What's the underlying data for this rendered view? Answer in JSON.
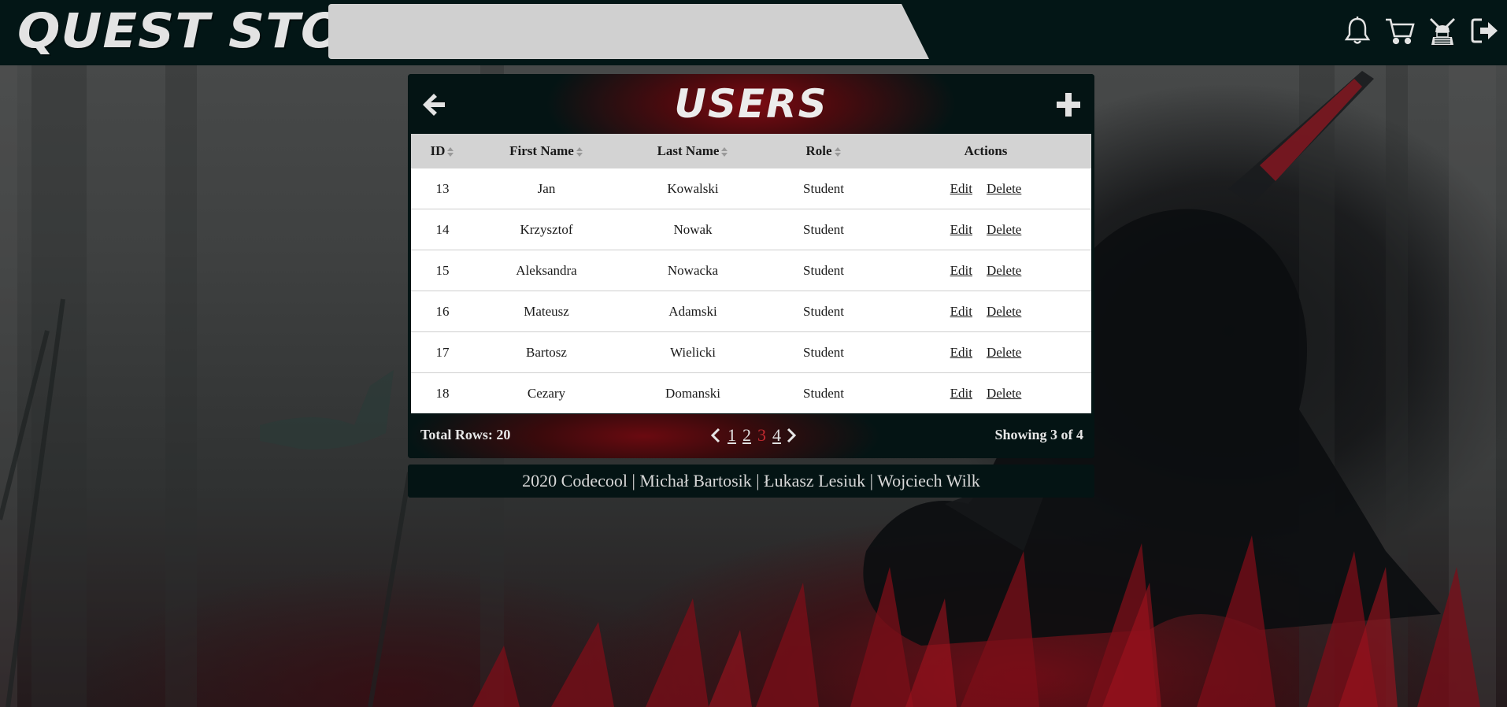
{
  "header": {
    "logo_text": "QUEST STORE",
    "search": {
      "value": "",
      "placeholder": ""
    },
    "icons": [
      "bell-icon",
      "cart-icon",
      "samurai-avatar-icon",
      "logout-icon"
    ]
  },
  "panel": {
    "title": "USERS",
    "back_icon": "arrow-left-icon",
    "add_icon": "plus-icon",
    "columns": [
      {
        "label": "ID",
        "sortable": true
      },
      {
        "label": "First Name",
        "sortable": true
      },
      {
        "label": "Last Name",
        "sortable": true
      },
      {
        "label": "Role",
        "sortable": true
      },
      {
        "label": "Actions",
        "sortable": false
      }
    ],
    "edit_label": "Edit",
    "delete_label": "Delete",
    "rows": [
      {
        "id": "13",
        "first": "Jan",
        "last": "Kowalski",
        "role": "Student"
      },
      {
        "id": "14",
        "first": "Krzysztof",
        "last": "Nowak",
        "role": "Student"
      },
      {
        "id": "15",
        "first": "Aleksandra",
        "last": "Nowacka",
        "role": "Student"
      },
      {
        "id": "16",
        "first": "Mateusz",
        "last": "Adamski",
        "role": "Student"
      },
      {
        "id": "17",
        "first": "Bartosz",
        "last": "Wielicki",
        "role": "Student"
      },
      {
        "id": "18",
        "first": "Cezary",
        "last": "Domanski",
        "role": "Student"
      }
    ],
    "footer": {
      "total_rows": "Total Rows: 20",
      "pages": [
        "1",
        "2",
        "3",
        "4"
      ],
      "current_page": "3",
      "showing": "Showing 3 of 4"
    }
  },
  "credits": "2020 Codecool | Michał Bartosik | Łukasz Lesiuk | Wojciech Wilk",
  "colors": {
    "topbar": "#031616",
    "panel": "#041414",
    "accent_red": "#7d0b12",
    "current_page": "#c0292f"
  }
}
